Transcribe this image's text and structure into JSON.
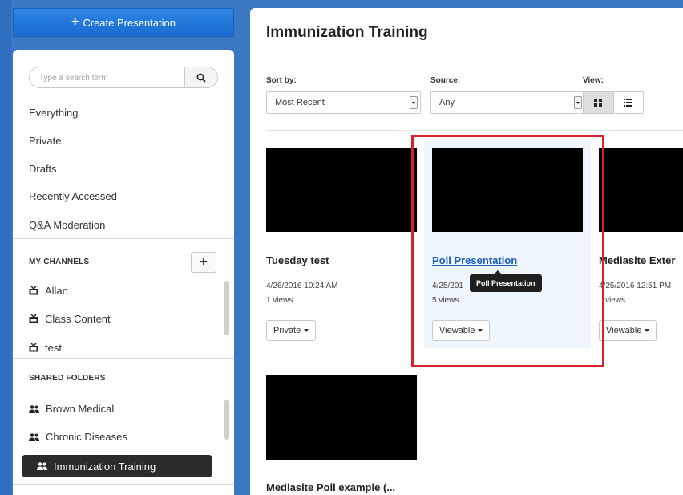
{
  "create_button": {
    "label": "Create Presentation"
  },
  "search": {
    "placeholder": "Type a search term"
  },
  "nav": [
    {
      "label": "Everything"
    },
    {
      "label": "Private"
    },
    {
      "label": "Drafts"
    },
    {
      "label": "Recently Accessed"
    },
    {
      "label": "Q&A Moderation"
    }
  ],
  "my_channels": {
    "heading": "MY CHANNELS",
    "items": [
      {
        "label": "Allan",
        "icon": "tv-icon"
      },
      {
        "label": "Class Content",
        "icon": "tv-icon"
      },
      {
        "label": "test",
        "icon": "tv-icon"
      }
    ]
  },
  "shared_folders": {
    "heading": "SHARED FOLDERS",
    "items": [
      {
        "label": "Brown Medical",
        "icon": "users-icon"
      },
      {
        "label": "Chronic Diseases",
        "icon": "users-icon"
      },
      {
        "label": "Immunization Training",
        "icon": "users-icon",
        "active": true
      }
    ]
  },
  "main": {
    "title": "Immunization Training",
    "sort": {
      "label": "Sort by:",
      "value": "Most Recent"
    },
    "source": {
      "label": "Source:",
      "value": "Any"
    },
    "view": {
      "label": "View:"
    },
    "cards": [
      {
        "title": "Tuesday test",
        "date": "4/26/2016 10:24 AM",
        "views": "1 views",
        "status": "Private"
      },
      {
        "title": "Poll Presentation",
        "date": "4/25/201",
        "views": "5 views",
        "status": "Viewable"
      },
      {
        "title": "Mediasite Exter",
        "date": "4/25/2016 12:51 PM",
        "views": "views",
        "status": "Viewable"
      },
      {
        "title": "Mediasite Poll example (..."
      }
    ],
    "tooltip": "Poll Presentation"
  },
  "colors": {
    "brand_blue": "#2d86e6",
    "highlight_red": "#d8232a",
    "link_blue": "#1a5dc0"
  }
}
